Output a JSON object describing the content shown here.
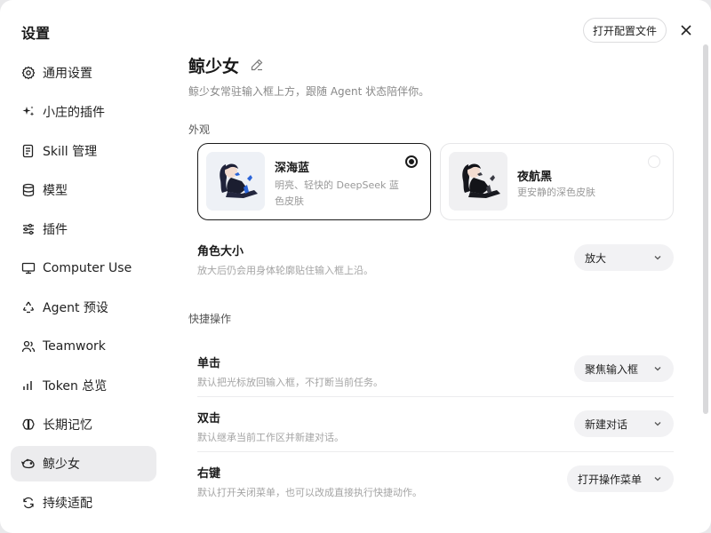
{
  "sidebar": {
    "title": "设置",
    "items": [
      {
        "label": "通用设置",
        "icon": "gear-icon"
      },
      {
        "label": "小庄的插件",
        "icon": "sparkle-icon"
      },
      {
        "label": "Skill 管理",
        "icon": "document-icon"
      },
      {
        "label": "模型",
        "icon": "database-icon"
      },
      {
        "label": "插件",
        "icon": "sliders-icon"
      },
      {
        "label": "Computer Use",
        "icon": "monitor-icon"
      },
      {
        "label": "Agent 预设",
        "icon": "recycle-icon"
      },
      {
        "label": "Teamwork",
        "icon": "users-icon"
      },
      {
        "label": "Token 总览",
        "icon": "bar-chart-icon"
      },
      {
        "label": "长期记忆",
        "icon": "brain-icon"
      },
      {
        "label": "鲸少女",
        "icon": "whale-icon",
        "active": true
      },
      {
        "label": "持续适配",
        "icon": "loop-icon"
      }
    ]
  },
  "header": {
    "open_config": "打开配置文件"
  },
  "main": {
    "title": "鲸少女",
    "description": "鲸少女常驻输入框上方，跟随 Agent 状态陪伴你。",
    "appearance_label": "外观",
    "skins": [
      {
        "name": "深海蓝",
        "desc": "明亮、轻快的 DeepSeek 蓝色皮肤",
        "selected": true
      },
      {
        "name": "夜航黑",
        "desc": "更安静的深色皮肤",
        "selected": false
      }
    ],
    "size": {
      "title": "角色大小",
      "sub": "放大后仍会用身体轮廓贴住输入框上沿。",
      "value": "放大"
    },
    "quick_label": "快捷操作",
    "actions": [
      {
        "title": "单击",
        "sub": "默认把光标放回输入框，不打断当前任务。",
        "value": "聚焦输入框"
      },
      {
        "title": "双击",
        "sub": "默认继承当前工作区并新建对话。",
        "value": "新建对话"
      },
      {
        "title": "右键",
        "sub": "默认打开关闭菜单，也可以改成直接执行快捷动作。",
        "value": "打开操作菜单"
      }
    ]
  },
  "colors": {
    "accent": "#1a1a1a",
    "active_bg": "#ececee",
    "select_bg": "#f2f2f4",
    "muted_text": "#999999"
  }
}
